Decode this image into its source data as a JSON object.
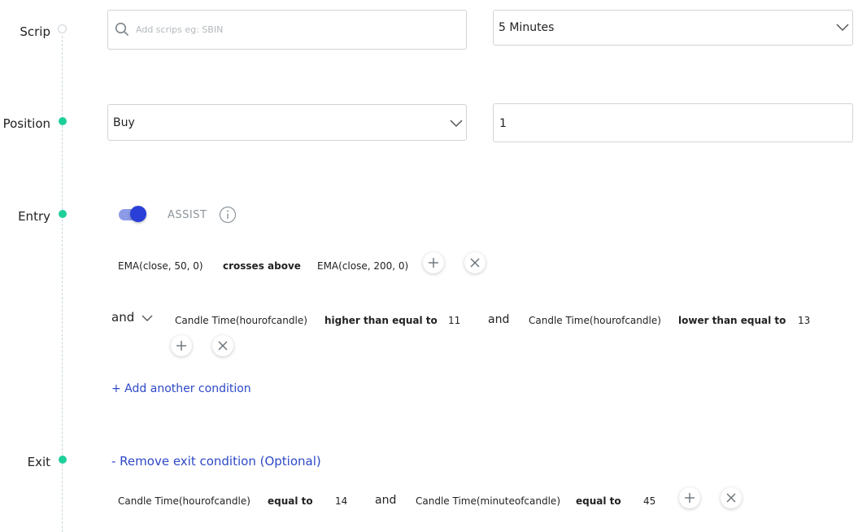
{
  "steps": {
    "scrip": "Scrip",
    "position": "Position",
    "entry": "Entry",
    "exit": "Exit"
  },
  "scrip": {
    "search_placeholder": "Add scrips eg: SBIN",
    "interval_value": "5 Minutes"
  },
  "position": {
    "side_value": "Buy",
    "quantity_value": "1"
  },
  "entry": {
    "assist_label": "ASSIST",
    "assist_enabled": true,
    "condition1": {
      "left": "EMA(close, 50, 0)",
      "operator": "crosses above",
      "right": "EMA(close, 200, 0)"
    },
    "joiner_label": "and",
    "condition2": {
      "left": "Candle Time(hourofcandle)",
      "operator": "higher than equal to",
      "value": "11",
      "and_label": "and",
      "left2": "Candle Time(hourofcandle)",
      "operator2": "lower than equal to",
      "value2": "13"
    },
    "add_condition_link": "+ Add another condition"
  },
  "exit": {
    "remove_link": "- Remove exit condition (Optional)",
    "condition": {
      "left": "Candle Time(hourofcandle)",
      "operator": "equal to",
      "value": "14",
      "and_label": "and",
      "left2": "Candle Time(minuteofcandle)",
      "operator2": "equal to",
      "value2": "45"
    }
  },
  "colors": {
    "accent": "#2e49c7",
    "dot_active": "#1fcf9a",
    "toggle_knob": "#2a3fd8",
    "toggle_track": "#8c9be8"
  }
}
